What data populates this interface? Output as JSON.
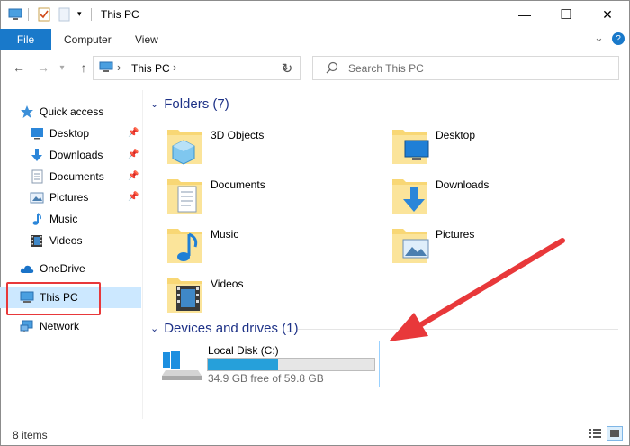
{
  "window": {
    "title": "This PC",
    "minimize": "—",
    "maximize": "☐",
    "close": "✕"
  },
  "ribbon": {
    "file": "File",
    "tabs": [
      "Computer",
      "View"
    ],
    "expand": "⌄",
    "help": "?"
  },
  "address": {
    "location": "This PC",
    "back": "←",
    "forward": "→",
    "up": "↑",
    "refresh": "↻",
    "dropdown": "⌄",
    "chevron": "›",
    "search_placeholder": "Search This PC"
  },
  "nav": {
    "quick_access": "Quick access",
    "quick_items": [
      {
        "label": "Desktop",
        "pinned": true
      },
      {
        "label": "Downloads",
        "pinned": true
      },
      {
        "label": "Documents",
        "pinned": true
      },
      {
        "label": "Pictures",
        "pinned": true
      },
      {
        "label": "Music",
        "pinned": false
      },
      {
        "label": "Videos",
        "pinned": false
      }
    ],
    "onedrive": "OneDrive",
    "this_pc": "This PC",
    "network": "Network"
  },
  "content": {
    "folders_heading": "Folders (7)",
    "folders": [
      "3D Objects",
      "Desktop",
      "Documents",
      "Downloads",
      "Music",
      "Pictures",
      "Videos"
    ],
    "devices_heading": "Devices and drives (1)",
    "drive": {
      "name": "Local Disk (C:)",
      "free": "34.9 GB free of 59.8 GB",
      "used_fraction": 0.42
    }
  },
  "status": {
    "items": "8 items"
  },
  "colors": {
    "accent": "#1979ca",
    "selection": "#cce8ff",
    "annotation": "#e8383a",
    "folder": "#f8d775"
  }
}
